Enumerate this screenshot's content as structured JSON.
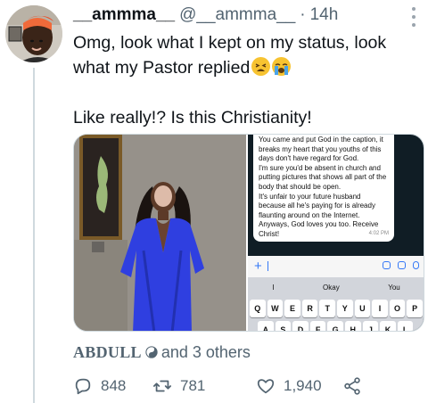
{
  "colors": {
    "text": "#0f1419",
    "muted": "#536471",
    "accent": "#3478f6",
    "border": "#cfd9de"
  },
  "tweet": {
    "display_name": "__ammma__",
    "handle": "@__ammma__",
    "separator": "·",
    "time": "14h",
    "text_line1": "Omg, look what I kept on my status, look what my Pastor replied",
    "emojis": [
      "weary-face",
      "crying-face"
    ],
    "text_line2": "Like really!? Is this Christianity!"
  },
  "media": {
    "chat": {
      "message": "You came and put God in the caption, it breaks my heart that you youths of this days don't have regard for God.\nI'm sure you'd be absent in church and putting pictures that shows all part of the body that should be open.\nIt's unfair to your future husband because all he's paying for is already flaunting around on the Internet.\nAnyways, God loves you too. Receive Christ!",
      "time": "4:02 PM",
      "composer_plus": "+",
      "suggestions": [
        "I",
        "Okay",
        "You"
      ],
      "keys_row1": [
        "Q",
        "W",
        "E",
        "R",
        "T",
        "Y",
        "U",
        "I",
        "O",
        "P"
      ],
      "keys_row2": [
        "A",
        "S",
        "D",
        "F",
        "G",
        "H",
        "J",
        "K",
        "L"
      ]
    }
  },
  "social": {
    "liker": "ABDULL",
    "others": "and 3 others"
  },
  "actions": {
    "replies": "848",
    "retweets": "781",
    "likes": "1,940"
  }
}
